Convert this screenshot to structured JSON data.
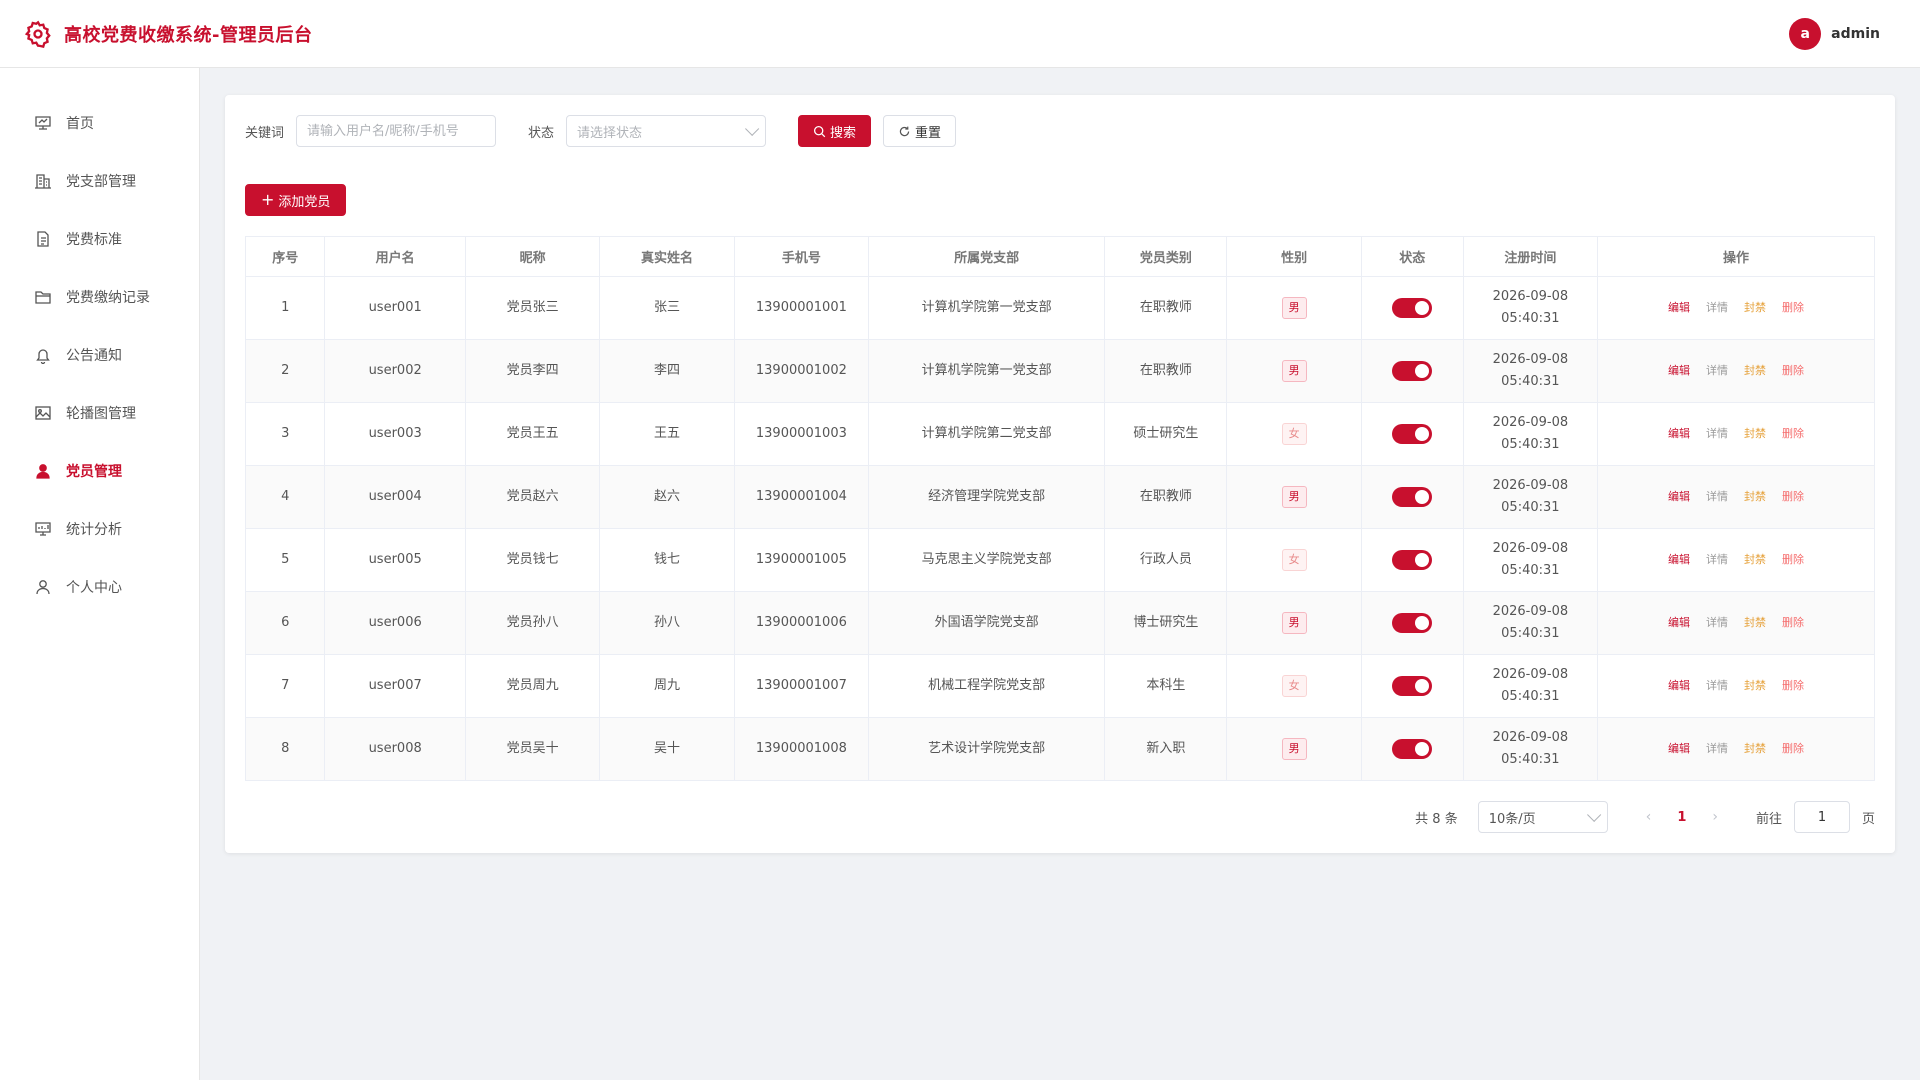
{
  "header": {
    "title": "高校党费收缴系统-管理员后台",
    "avatar_letter": "a",
    "username": "admin",
    "brand_color": "#c8102e"
  },
  "sidebar": {
    "items": [
      {
        "label": "首页",
        "icon": "dashboard-icon",
        "active": false
      },
      {
        "label": "党支部管理",
        "icon": "building-icon",
        "active": false
      },
      {
        "label": "党费标准",
        "icon": "document-icon",
        "active": false
      },
      {
        "label": "党费缴纳记录",
        "icon": "folder-icon",
        "active": false
      },
      {
        "label": "公告通知",
        "icon": "bell-icon",
        "active": false
      },
      {
        "label": "轮播图管理",
        "icon": "image-icon",
        "active": false
      },
      {
        "label": "党员管理",
        "icon": "user-filled-icon",
        "active": true
      },
      {
        "label": "统计分析",
        "icon": "chart-icon",
        "active": false
      },
      {
        "label": "个人中心",
        "icon": "user-icon",
        "active": false
      }
    ]
  },
  "filters": {
    "keyword_label": "关键词",
    "keyword_placeholder": "请输入用户名/昵称/手机号",
    "status_label": "状态",
    "status_placeholder": "请选择状态",
    "search_label": "搜索",
    "reset_label": "重置"
  },
  "add_button_label": "添加党员",
  "table": {
    "columns": [
      "序号",
      "用户名",
      "昵称",
      "真实姓名",
      "手机号",
      "所属党支部",
      "党员类别",
      "性别",
      "状态",
      "注册时间",
      "操作"
    ],
    "rows": [
      {
        "index": "1",
        "username": "user001",
        "nickname": "党员张三",
        "realname": "张三",
        "phone": "13900001001",
        "branch": "计算机学院第一党支部",
        "category": "在职教师",
        "gender": "男",
        "gender_type": "male",
        "status_on": true,
        "date": "2026-09-08",
        "time": "05:40:31"
      },
      {
        "index": "2",
        "username": "user002",
        "nickname": "党员李四",
        "realname": "李四",
        "phone": "13900001002",
        "branch": "计算机学院第一党支部",
        "category": "在职教师",
        "gender": "男",
        "gender_type": "male",
        "status_on": true,
        "date": "2026-09-08",
        "time": "05:40:31"
      },
      {
        "index": "3",
        "username": "user003",
        "nickname": "党员王五",
        "realname": "王五",
        "phone": "13900001003",
        "branch": "计算机学院第二党支部",
        "category": "硕士研究生",
        "gender": "女",
        "gender_type": "female",
        "status_on": true,
        "date": "2026-09-08",
        "time": "05:40:31"
      },
      {
        "index": "4",
        "username": "user004",
        "nickname": "党员赵六",
        "realname": "赵六",
        "phone": "13900001004",
        "branch": "经济管理学院党支部",
        "category": "在职教师",
        "gender": "男",
        "gender_type": "male",
        "status_on": true,
        "date": "2026-09-08",
        "time": "05:40:31"
      },
      {
        "index": "5",
        "username": "user005",
        "nickname": "党员钱七",
        "realname": "钱七",
        "phone": "13900001005",
        "branch": "马克思主义学院党支部",
        "category": "行政人员",
        "gender": "女",
        "gender_type": "female",
        "status_on": true,
        "date": "2026-09-08",
        "time": "05:40:31"
      },
      {
        "index": "6",
        "username": "user006",
        "nickname": "党员孙八",
        "realname": "孙八",
        "phone": "13900001006",
        "branch": "外国语学院党支部",
        "category": "博士研究生",
        "gender": "男",
        "gender_type": "male",
        "status_on": true,
        "date": "2026-09-08",
        "time": "05:40:31"
      },
      {
        "index": "7",
        "username": "user007",
        "nickname": "党员周九",
        "realname": "周九",
        "phone": "13900001007",
        "branch": "机械工程学院党支部",
        "category": "本科生",
        "gender": "女",
        "gender_type": "female",
        "status_on": true,
        "date": "2026-09-08",
        "time": "05:40:31"
      },
      {
        "index": "8",
        "username": "user008",
        "nickname": "党员吴十",
        "realname": "吴十",
        "phone": "13900001008",
        "branch": "艺术设计学院党支部",
        "category": "新入职",
        "gender": "男",
        "gender_type": "male",
        "status_on": true,
        "date": "2026-09-08",
        "time": "05:40:31"
      }
    ],
    "actions": {
      "edit": "编辑",
      "detail": "详情",
      "ban": "封禁",
      "delete": "删除"
    }
  },
  "pagination": {
    "total_text": "共 8 条",
    "page_size": "10条/页",
    "current_page": "1",
    "goto_label": "前往",
    "goto_value": "1",
    "page_suffix": "页"
  }
}
